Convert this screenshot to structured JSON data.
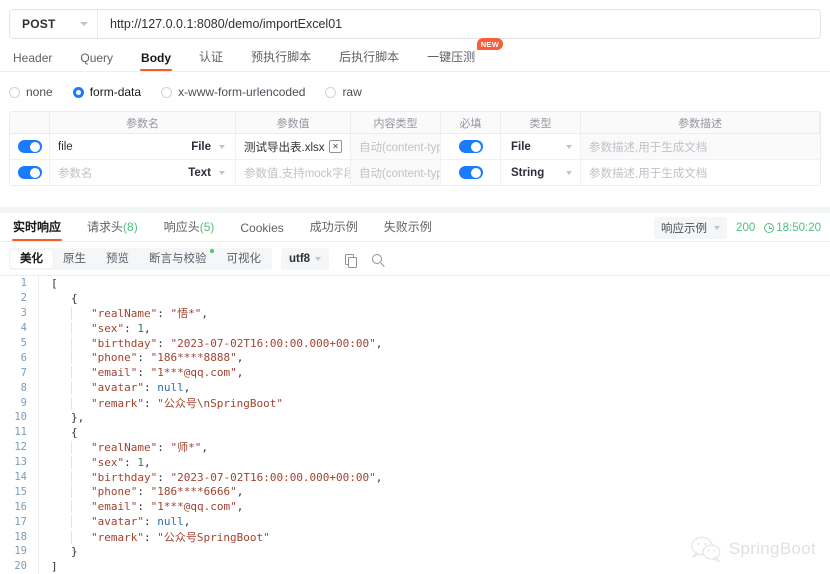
{
  "request": {
    "method": "POST",
    "url": "http://127.0.0.1:8080/demo/importExcel01",
    "tabs": [
      {
        "label": "Header"
      },
      {
        "label": "Query"
      },
      {
        "label": "Body"
      },
      {
        "label": "认证"
      },
      {
        "label": "预执行脚本"
      },
      {
        "label": "后执行脚本"
      },
      {
        "label": "一键压测",
        "badge": "NEW"
      }
    ],
    "body_types": [
      {
        "label": "none"
      },
      {
        "label": "form-data"
      },
      {
        "label": "x-www-form-urlencoded"
      },
      {
        "label": "raw"
      }
    ]
  },
  "param_table": {
    "headers": [
      "",
      "参数名",
      "参数值",
      "内容类型",
      "必填",
      "类型",
      "参数描述"
    ],
    "rows": [
      {
        "name_value": "file",
        "name_placeholder": "参数名",
        "name_kind": "File",
        "value_value": "测试导出表.xlsx",
        "value_placeholder": "",
        "content_type": "自动(content-type)",
        "type": "File",
        "desc_placeholder": "参数描述,用于生成文档"
      },
      {
        "name_value": "",
        "name_placeholder": "参数名",
        "name_kind": "Text",
        "value_value": "",
        "value_placeholder": "参数值,支持mock字段变",
        "content_type": "自动(content-type)",
        "type": "String",
        "desc_placeholder": "参数描述,用于生成文档"
      }
    ]
  },
  "response": {
    "tabs": [
      {
        "label": "实时响应",
        "count": ""
      },
      {
        "label": "请求头",
        "count": "(8)"
      },
      {
        "label": "响应头",
        "count": "(5)"
      },
      {
        "label": "Cookies",
        "count": ""
      },
      {
        "label": "成功示例",
        "count": ""
      },
      {
        "label": "失败示例",
        "count": ""
      }
    ],
    "example_selector": "响应示例",
    "status_code": "200",
    "time": "18:50:20",
    "viewer_tabs": [
      {
        "label": "美化"
      },
      {
        "label": "原生"
      },
      {
        "label": "预览"
      },
      {
        "label": "断言与校验"
      },
      {
        "label": "可视化"
      }
    ],
    "encoding": "utf8",
    "icons": [
      "copy-icon",
      "search-icon"
    ]
  },
  "code": {
    "lines": [
      {
        "num": "1",
        "indent": 0,
        "parts": [
          {
            "t": "[",
            "c": "p"
          }
        ]
      },
      {
        "num": "2",
        "indent": 1,
        "parts": [
          {
            "t": "{",
            "c": "p"
          }
        ]
      },
      {
        "num": "3",
        "indent": 2,
        "parts": [
          {
            "t": "\"realName\"",
            "c": "k"
          },
          {
            "t": ": ",
            "c": "p"
          },
          {
            "t": "\"悟*\"",
            "c": "s"
          },
          {
            "t": ",",
            "c": "p"
          }
        ]
      },
      {
        "num": "4",
        "indent": 2,
        "parts": [
          {
            "t": "\"sex\"",
            "c": "k"
          },
          {
            "t": ": ",
            "c": "p"
          },
          {
            "t": "1",
            "c": "n"
          },
          {
            "t": ",",
            "c": "p"
          }
        ]
      },
      {
        "num": "5",
        "indent": 2,
        "parts": [
          {
            "t": "\"birthday\"",
            "c": "k"
          },
          {
            "t": ": ",
            "c": "p"
          },
          {
            "t": "\"2023-07-02T16:00:00.000+00:00\"",
            "c": "s"
          },
          {
            "t": ",",
            "c": "p"
          }
        ]
      },
      {
        "num": "6",
        "indent": 2,
        "parts": [
          {
            "t": "\"phone\"",
            "c": "k"
          },
          {
            "t": ": ",
            "c": "p"
          },
          {
            "t": "\"186****8888\"",
            "c": "s"
          },
          {
            "t": ",",
            "c": "p"
          }
        ]
      },
      {
        "num": "7",
        "indent": 2,
        "parts": [
          {
            "t": "\"email\"",
            "c": "k"
          },
          {
            "t": ": ",
            "c": "p"
          },
          {
            "t": "\"1***@qq.com\"",
            "c": "s"
          },
          {
            "t": ",",
            "c": "p"
          }
        ]
      },
      {
        "num": "8",
        "indent": 2,
        "parts": [
          {
            "t": "\"avatar\"",
            "c": "k"
          },
          {
            "t": ": ",
            "c": "p"
          },
          {
            "t": "null",
            "c": "nul"
          },
          {
            "t": ",",
            "c": "p"
          }
        ]
      },
      {
        "num": "9",
        "indent": 2,
        "parts": [
          {
            "t": "\"remark\"",
            "c": "k"
          },
          {
            "t": ": ",
            "c": "p"
          },
          {
            "t": "\"公众号\\nSpringBoot\"",
            "c": "s"
          }
        ]
      },
      {
        "num": "10",
        "indent": 1,
        "parts": [
          {
            "t": "},",
            "c": "p"
          }
        ]
      },
      {
        "num": "11",
        "indent": 1,
        "parts": [
          {
            "t": "{",
            "c": "p"
          }
        ]
      },
      {
        "num": "12",
        "indent": 2,
        "parts": [
          {
            "t": "\"realName\"",
            "c": "k"
          },
          {
            "t": ": ",
            "c": "p"
          },
          {
            "t": "\"师*\"",
            "c": "s"
          },
          {
            "t": ",",
            "c": "p"
          }
        ]
      },
      {
        "num": "13",
        "indent": 2,
        "parts": [
          {
            "t": "\"sex\"",
            "c": "k"
          },
          {
            "t": ": ",
            "c": "p"
          },
          {
            "t": "1",
            "c": "n"
          },
          {
            "t": ",",
            "c": "p"
          }
        ]
      },
      {
        "num": "14",
        "indent": 2,
        "parts": [
          {
            "t": "\"birthday\"",
            "c": "k"
          },
          {
            "t": ": ",
            "c": "p"
          },
          {
            "t": "\"2023-07-02T16:00:00.000+00:00\"",
            "c": "s"
          },
          {
            "t": ",",
            "c": "p"
          }
        ]
      },
      {
        "num": "15",
        "indent": 2,
        "parts": [
          {
            "t": "\"phone\"",
            "c": "k"
          },
          {
            "t": ": ",
            "c": "p"
          },
          {
            "t": "\"186****6666\"",
            "c": "s"
          },
          {
            "t": ",",
            "c": "p"
          }
        ]
      },
      {
        "num": "16",
        "indent": 2,
        "parts": [
          {
            "t": "\"email\"",
            "c": "k"
          },
          {
            "t": ": ",
            "c": "p"
          },
          {
            "t": "\"1***@qq.com\"",
            "c": "s"
          },
          {
            "t": ",",
            "c": "p"
          }
        ]
      },
      {
        "num": "17",
        "indent": 2,
        "parts": [
          {
            "t": "\"avatar\"",
            "c": "k"
          },
          {
            "t": ": ",
            "c": "p"
          },
          {
            "t": "null",
            "c": "nul"
          },
          {
            "t": ",",
            "c": "p"
          }
        ]
      },
      {
        "num": "18",
        "indent": 2,
        "parts": [
          {
            "t": "\"remark\"",
            "c": "k"
          },
          {
            "t": ": ",
            "c": "p"
          },
          {
            "t": "\"公众号SpringBoot\"",
            "c": "s"
          }
        ]
      },
      {
        "num": "19",
        "indent": 1,
        "parts": [
          {
            "t": "}",
            "c": "p"
          }
        ]
      },
      {
        "num": "20",
        "indent": 0,
        "parts": [
          {
            "t": "]",
            "c": "p"
          }
        ]
      }
    ]
  },
  "watermark": {
    "icon": "wechat-icon",
    "text": "SpringBoot"
  },
  "colors": {
    "accent_orange": "#fa5a28",
    "toggle_blue": "#1a7bff",
    "status_green": "#4cc27f",
    "badge_red": "#f95e3a"
  }
}
